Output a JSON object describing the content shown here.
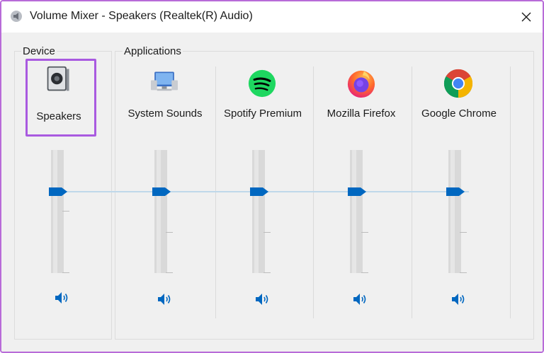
{
  "window": {
    "title": "Volume Mixer - Speakers (Realtek(R) Audio)",
    "close_glyph": "✕"
  },
  "groups": {
    "device_label": "Device",
    "applications_label": "Applications"
  },
  "device": {
    "name": "Speakers",
    "icon": "speaker-icon",
    "volume_level": 0.66
  },
  "applications": [
    {
      "name": "System Sounds",
      "icon": "system-sounds-icon",
      "volume_level": 0.66
    },
    {
      "name": "Spotify Premium",
      "icon": "spotify-icon",
      "volume_level": 0.66
    },
    {
      "name": "Mozilla Firefox",
      "icon": "firefox-icon",
      "volume_level": 0.66
    },
    {
      "name": "Google Chrome",
      "icon": "chrome-icon",
      "volume_level": 0.66
    }
  ],
  "colors": {
    "accent": "#0067c0",
    "highlight_border": "#a95ae0",
    "spotify_green": "#1ed760"
  }
}
